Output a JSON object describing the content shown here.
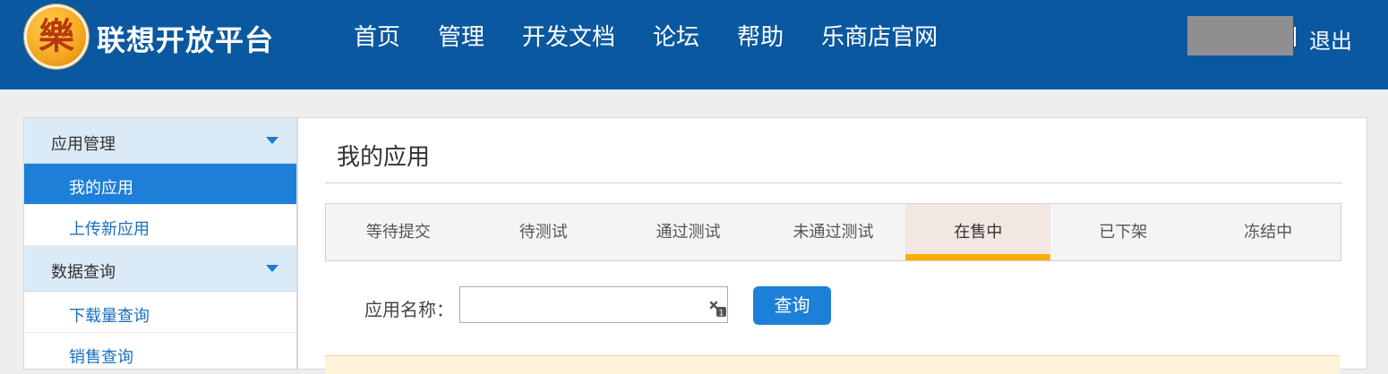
{
  "header": {
    "logo_glyph": "樂",
    "logo_text": "联想开放平台",
    "nav": [
      "首页",
      "管理",
      "开发文档",
      "论坛",
      "帮助",
      "乐商店官网"
    ],
    "logout": "退出",
    "bg_color": "#0a58a0"
  },
  "sidebar": {
    "groups": [
      {
        "label": "应用管理",
        "items": [
          {
            "label": "我的应用",
            "active": true
          },
          {
            "label": "上传新应用",
            "active": false
          }
        ]
      },
      {
        "label": "数据查询",
        "items": [
          {
            "label": "下载量查询",
            "active": false
          },
          {
            "label": "销售查询",
            "active": false
          }
        ]
      }
    ]
  },
  "main": {
    "title": "我的应用",
    "tabs": [
      "等待提交",
      "待测试",
      "通过测试",
      "未通过测试",
      "在售中",
      "已下架",
      "冻结中"
    ],
    "active_tab": "在售中",
    "search": {
      "label": "应用名称：",
      "value": "",
      "button": "查询"
    },
    "accent_color": "#1e7fd8",
    "tab_highlight_color": "#ffae00"
  }
}
